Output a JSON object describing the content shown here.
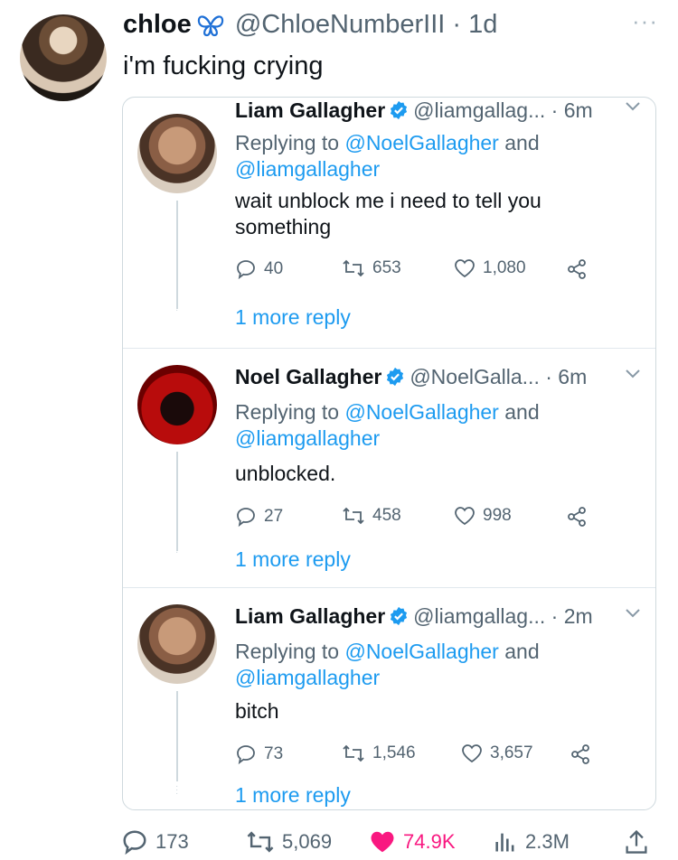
{
  "tweet": {
    "name": "chloe",
    "handle": "@ChloeNumberIII",
    "time": "· 1d",
    "text": "i'm fucking crying",
    "more_label": "···"
  },
  "replies": [
    {
      "name": "Liam Gallagher",
      "handle": "@liamgallag...",
      "time": "· 6m",
      "replying_prefix": "Replying to ",
      "mention1": "@NoelGallagher",
      "and": " and",
      "mention2": "@liamgallagher",
      "body": "wait unblock me i need to tell you something",
      "replies": "40",
      "retweets": "653",
      "likes": "1,080",
      "more_reply": "1 more reply"
    },
    {
      "name": "Noel Gallagher",
      "handle": "@NoelGalla...",
      "time": "· 6m",
      "replying_prefix": "Replying to ",
      "mention1": "@NoelGallagher",
      "and": " and",
      "mention2": "@liamgallagher",
      "body": "unblocked.",
      "replies": "27",
      "retweets": "458",
      "likes": "998",
      "more_reply": "1 more reply"
    },
    {
      "name": "Liam Gallagher",
      "handle": "@liamgallag...",
      "time": "· 2m",
      "replying_prefix": "Replying to ",
      "mention1": "@NoelGallagher",
      "and": " and",
      "mention2": "@liamgallagher",
      "body": "bitch",
      "replies": "73",
      "retweets": "1,546",
      "likes": "3,657",
      "more_reply": "1 more reply"
    }
  ],
  "stats": {
    "replies": "173",
    "retweets": "5,069",
    "likes": "74.9K",
    "views": "2.3M"
  },
  "colors": {
    "accent": "#1d9bf0",
    "like": "#f91880",
    "muted": "#536471",
    "verified": "#1d9bf0"
  },
  "icons": {
    "verified": "verified-badge-icon",
    "butterfly": "butterfly-icon",
    "reply": "reply-icon",
    "retweet": "retweet-icon",
    "like": "heart-icon",
    "share": "share-icon",
    "views": "views-icon",
    "upload": "upload-icon"
  }
}
